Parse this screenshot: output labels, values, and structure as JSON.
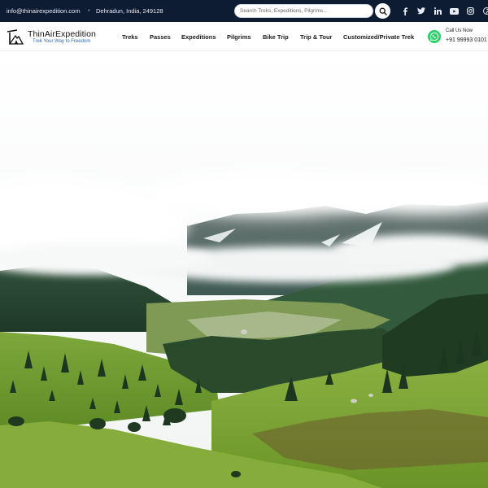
{
  "topbar": {
    "email": "info@thinairexpedition.com",
    "separator": "•",
    "address": "Dehradun, India, 249128",
    "search_placeholder": "Search Treks, Expeditions, Pilgrims...",
    "search_icon": "search-icon",
    "social_icons": [
      "facebook-icon",
      "twitter-icon",
      "linkedin-icon",
      "youtube-icon",
      "instagram-icon",
      "pinterest-icon"
    ]
  },
  "header": {
    "brand": "ThinAirExpedition",
    "tagline": "Trek Your Way to Freedom",
    "menu": [
      "Treks",
      "Passes",
      "Expeditions",
      "Pilgrims",
      "Bike Trip",
      "Trip & Tour",
      "Customized/Private Trek"
    ],
    "call_label": "Call Us Now",
    "phone": "+91 99993 0101",
    "whatsapp_icon": "whatsapp-icon"
  },
  "colors": {
    "topbar_bg": "#0d1b33",
    "tagline": "#2b6ab0",
    "whatsapp": "#25d366"
  }
}
